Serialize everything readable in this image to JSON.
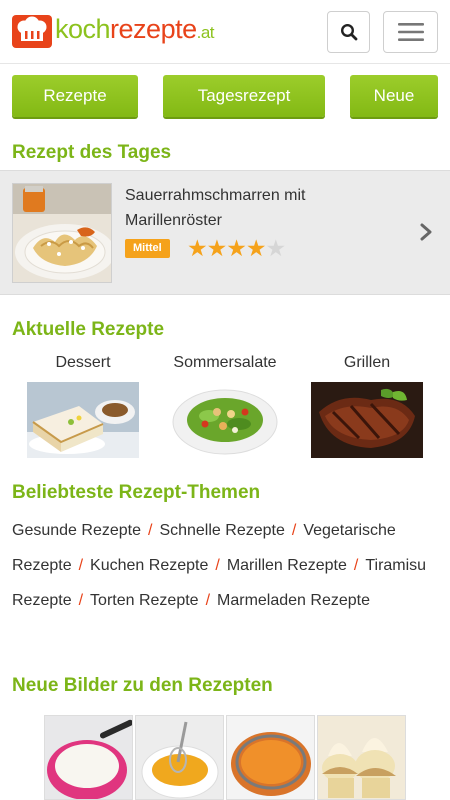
{
  "header": {
    "logo": {
      "koch": "koch",
      "rezepte": "rezepte",
      "tld": ".at"
    },
    "search_icon": "search-icon",
    "menu_icon": "hamburger-menu-icon"
  },
  "nav": {
    "items": [
      {
        "label": "Rezepte"
      },
      {
        "label": "Tagesrezept"
      },
      {
        "label": "Neue"
      }
    ],
    "accent": "#8cc21e"
  },
  "recipe_of_day": {
    "heading": "Rezept des Tages",
    "title": "Sauerrahmschmarren mit Marillenröster",
    "difficulty": "Mittel",
    "rating": 4,
    "rating_max": 5,
    "chevron_icon": "chevron-right-icon"
  },
  "current": {
    "heading": "Aktuelle Rezepte",
    "items": [
      {
        "label": "Dessert"
      },
      {
        "label": "Sommersalate"
      },
      {
        "label": "Grillen"
      }
    ]
  },
  "topics": {
    "heading": "Beliebteste Rezept-Themen",
    "items": [
      "Gesunde Rezepte",
      "Schnelle Rezepte",
      "Vegetarische Rezepte",
      "Kuchen Rezepte",
      "Marillen Rezepte",
      "Tiramisu Rezepte",
      "Torten Rezepte",
      "Marmeladen Rezepte"
    ],
    "separator": "/"
  },
  "new_images": {
    "heading": "Neue Bilder zu den Rezepten"
  },
  "colors": {
    "brand_green": "#8cc21e",
    "heading_green": "#7cb518",
    "brand_red": "#e8431a",
    "badge_orange": "#f5a21b"
  }
}
